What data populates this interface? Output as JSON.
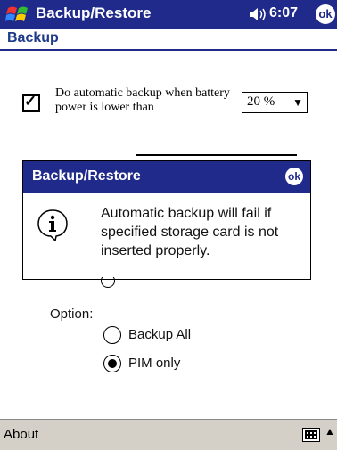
{
  "titlebar": {
    "app_title": "Backup/Restore",
    "time": "6:07",
    "ok": "ok"
  },
  "page": {
    "title": "Backup"
  },
  "auto_backup": {
    "label": "Do automatic backup when battery power is lower than",
    "threshold": "20 %"
  },
  "dialog": {
    "title": "Backup/Restore",
    "ok": "ok",
    "message": "Automatic backup will fail if specified storage card is not inserted properly."
  },
  "options": {
    "label": "Option:",
    "items": [
      {
        "label": "Backup All",
        "selected": false
      },
      {
        "label": "PIM only",
        "selected": true
      }
    ]
  },
  "bottom": {
    "about": "About"
  },
  "colors": {
    "title_bar": "#1f2a8a",
    "heading": "#1f3a8a",
    "bottom_bar": "#d4d0c8"
  }
}
